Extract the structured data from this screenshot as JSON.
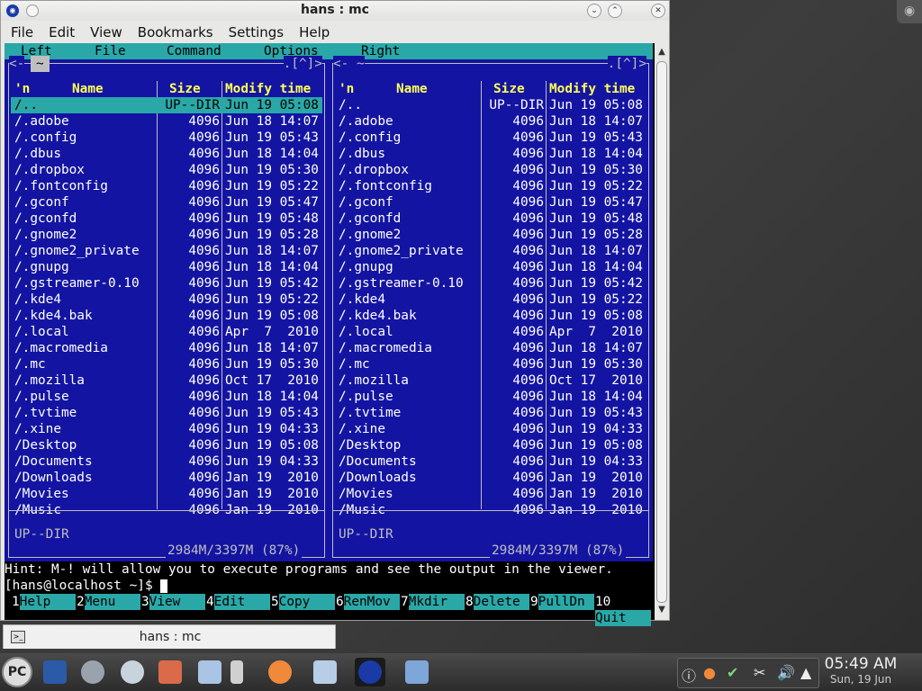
{
  "window": {
    "title": "hans : mc",
    "menu": [
      "File",
      "Edit",
      "View",
      "Bookmarks",
      "Settings",
      "Help"
    ],
    "tab_label": "hans : mc"
  },
  "mc": {
    "menu": [
      "Left",
      "File",
      "Command",
      "Options",
      "Right"
    ],
    "left": {
      "head_left": "<- ",
      "head_dir": "~",
      "head_right": ".[^]>",
      "col_sort": "'n",
      "col_name": "Name",
      "col_size": "Size",
      "col_mtime": "Modify time",
      "mini_status": "UP--DIR",
      "disk": "2984M/3397M (87%)"
    },
    "right": {
      "head_left": "<- ~",
      "head_right": ".[^]>",
      "col_sort": "'n",
      "col_name": "Name",
      "col_size": "Size",
      "col_mtime": "Modify time",
      "mini_status": "UP--DIR",
      "disk": "2984M/3397M (87%)"
    },
    "files": [
      {
        "name": "/..",
        "size": "UP--DIR",
        "mtime": "Jun 19 05:08"
      },
      {
        "name": "/.adobe",
        "size": "4096",
        "mtime": "Jun 18 14:07"
      },
      {
        "name": "/.config",
        "size": "4096",
        "mtime": "Jun 19 05:43"
      },
      {
        "name": "/.dbus",
        "size": "4096",
        "mtime": "Jun 18 14:04"
      },
      {
        "name": "/.dropbox",
        "size": "4096",
        "mtime": "Jun 19 05:30"
      },
      {
        "name": "/.fontconfig",
        "size": "4096",
        "mtime": "Jun 19 05:22"
      },
      {
        "name": "/.gconf",
        "size": "4096",
        "mtime": "Jun 19 05:47"
      },
      {
        "name": "/.gconfd",
        "size": "4096",
        "mtime": "Jun 19 05:48"
      },
      {
        "name": "/.gnome2",
        "size": "4096",
        "mtime": "Jun 19 05:28"
      },
      {
        "name": "/.gnome2_private",
        "size": "4096",
        "mtime": "Jun 18 14:07"
      },
      {
        "name": "/.gnupg",
        "size": "4096",
        "mtime": "Jun 18 14:04"
      },
      {
        "name": "/.gstreamer-0.10",
        "size": "4096",
        "mtime": "Jun 19 05:42"
      },
      {
        "name": "/.kde4",
        "size": "4096",
        "mtime": "Jun 19 05:22"
      },
      {
        "name": "/.kde4.bak",
        "size": "4096",
        "mtime": "Jun 19 05:08"
      },
      {
        "name": "/.local",
        "size": "4096",
        "mtime": "Apr  7  2010"
      },
      {
        "name": "/.macromedia",
        "size": "4096",
        "mtime": "Jun 18 14:07"
      },
      {
        "name": "/.mc",
        "size": "4096",
        "mtime": "Jun 19 05:30"
      },
      {
        "name": "/.mozilla",
        "size": "4096",
        "mtime": "Oct 17  2010"
      },
      {
        "name": "/.pulse",
        "size": "4096",
        "mtime": "Jun 18 14:04"
      },
      {
        "name": "/.tvtime",
        "size": "4096",
        "mtime": "Jun 19 05:43"
      },
      {
        "name": "/.xine",
        "size": "4096",
        "mtime": "Jun 19 04:33"
      },
      {
        "name": "/Desktop",
        "size": "4096",
        "mtime": "Jun 19 05:08"
      },
      {
        "name": "/Documents",
        "size": "4096",
        "mtime": "Jun 19 04:33"
      },
      {
        "name": "/Downloads",
        "size": "4096",
        "mtime": "Jan 19  2010"
      },
      {
        "name": "/Movies",
        "size": "4096",
        "mtime": "Jan 19  2010"
      },
      {
        "name": "/Music",
        "size": "4096",
        "mtime": "Jan 19  2010"
      }
    ],
    "hint": "Hint: M-! will allow you to execute programs and see the output in the viewer.",
    "prompt": "[hans@localhost ~]$ ",
    "fkeys": [
      {
        "num": "1",
        "label": "Help"
      },
      {
        "num": "2",
        "label": "Menu"
      },
      {
        "num": "3",
        "label": "View"
      },
      {
        "num": "4",
        "label": "Edit"
      },
      {
        "num": "5",
        "label": "Copy"
      },
      {
        "num": "6",
        "label": "RenMov"
      },
      {
        "num": "7",
        "label": "Mkdir"
      },
      {
        "num": "8",
        "label": "Delete"
      },
      {
        "num": "9",
        "label": "PullDn"
      },
      {
        "num": "10",
        "label": "Quit"
      }
    ]
  },
  "taskbar": {
    "start_label": "PC",
    "clock_time": "05:49 AM",
    "clock_date": "Sun, 19 Jun",
    "launchers": [
      "desktop-icon",
      "system-settings-icon",
      "configure-icon",
      "package-icon",
      "file-manager-icon",
      "notes-icon",
      "fruit-icon",
      "removable-drive-icon",
      "mc-icon",
      "network-icon"
    ],
    "tray": [
      "info-icon",
      "fruit-tray-icon",
      "check-icon",
      "scissors-icon",
      "volume-icon",
      "arrow-up-icon"
    ]
  }
}
